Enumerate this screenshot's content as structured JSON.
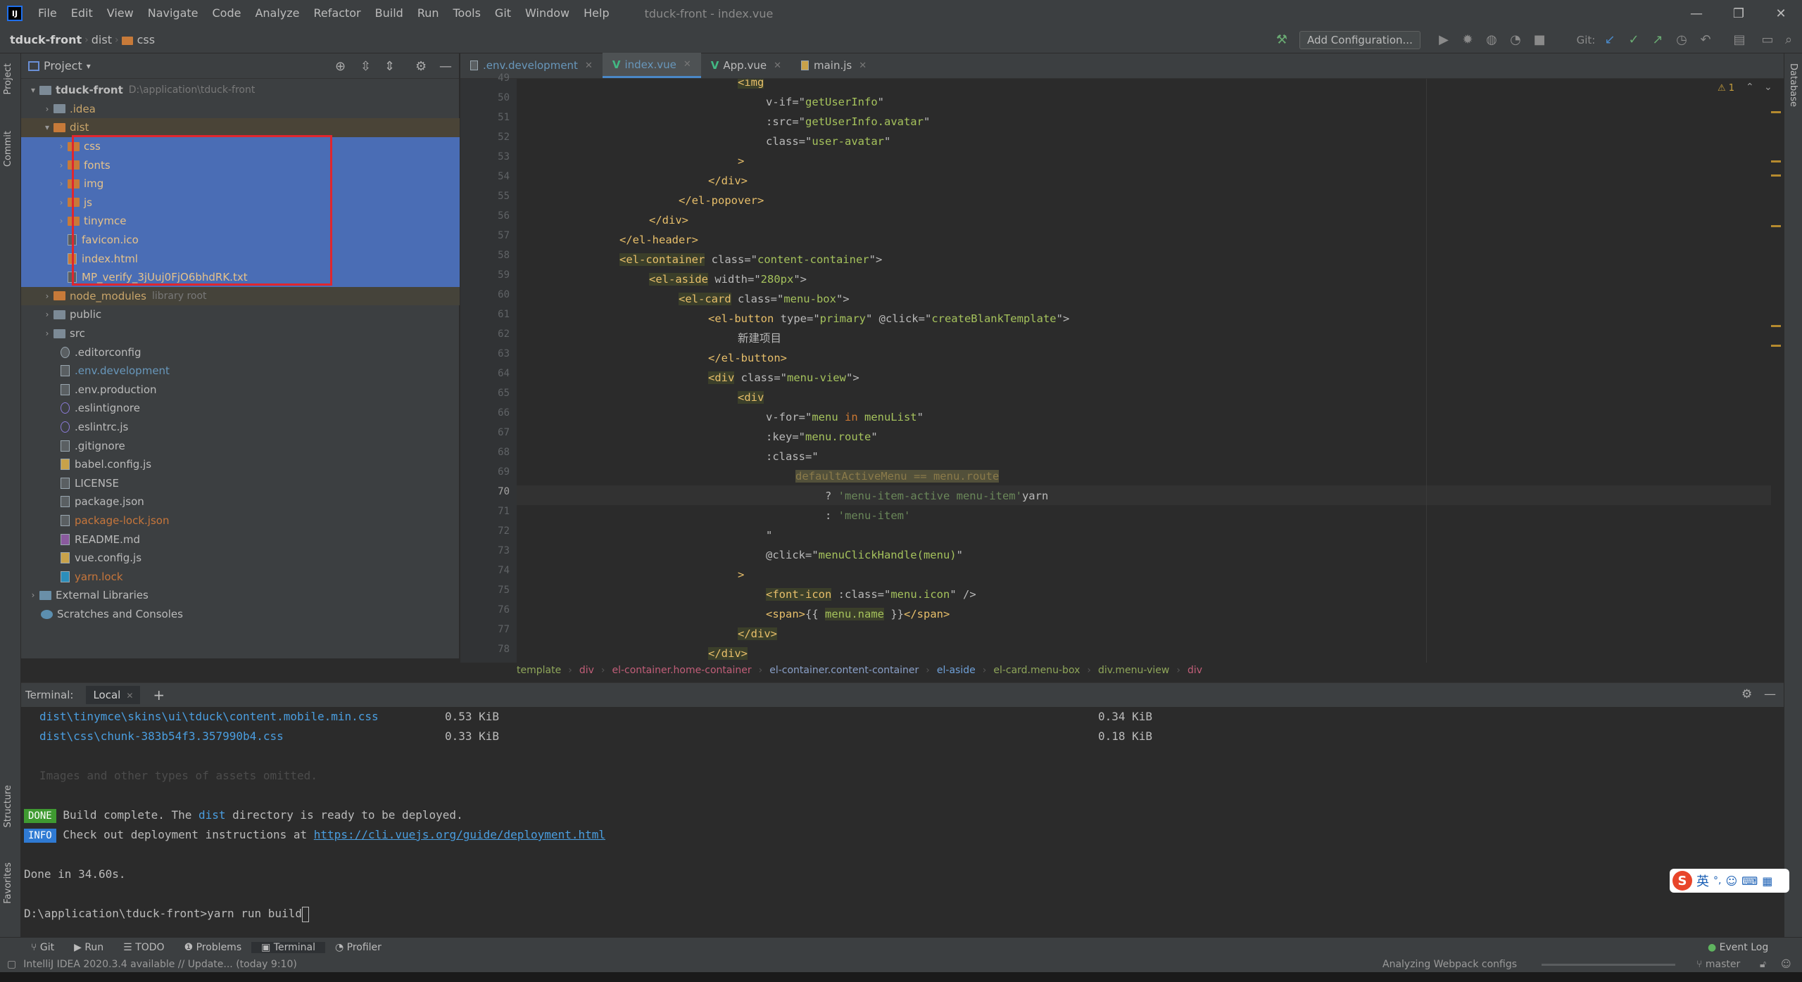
{
  "menu": {
    "items": [
      "File",
      "Edit",
      "View",
      "Navigate",
      "Code",
      "Analyze",
      "Refactor",
      "Build",
      "Run",
      "Tools",
      "Git",
      "Window",
      "Help"
    ],
    "window_title": "tduck-front - index.vue"
  },
  "navbar": {
    "crumbs": [
      "tduck-front",
      "dist",
      "css"
    ],
    "add_configuration": "Add Configuration...",
    "git_label": "Git:"
  },
  "left_strip": {
    "project": "Project",
    "commit": "Commit",
    "structure": "Structure",
    "favorites": "Favorites"
  },
  "right_strip": {
    "database": "Database"
  },
  "project_panel": {
    "title": "Project",
    "tree": [
      {
        "label": "tduck-front",
        "hint": "D:\\application\\tduck-front"
      },
      {
        "label": ".idea"
      },
      {
        "label": "dist"
      },
      {
        "label": "css"
      },
      {
        "label": "fonts"
      },
      {
        "label": "img"
      },
      {
        "label": "js"
      },
      {
        "label": "tinymce"
      },
      {
        "label": "favicon.ico"
      },
      {
        "label": "index.html"
      },
      {
        "label": "MP_verify_3jUuj0FjO6bhdRK.txt"
      },
      {
        "label": "node_modules",
        "hint": "library root"
      },
      {
        "label": "public"
      },
      {
        "label": "src"
      },
      {
        "label": ".editorconfig"
      },
      {
        "label": ".env.development"
      },
      {
        "label": ".env.production"
      },
      {
        "label": ".eslintignore"
      },
      {
        "label": ".eslintrc.js"
      },
      {
        "label": ".gitignore"
      },
      {
        "label": "babel.config.js"
      },
      {
        "label": "LICENSE"
      },
      {
        "label": "package.json"
      },
      {
        "label": "package-lock.json"
      },
      {
        "label": "README.md"
      },
      {
        "label": "vue.config.js"
      },
      {
        "label": "yarn.lock"
      },
      {
        "label": "External Libraries"
      },
      {
        "label": "Scratches and Consoles"
      }
    ]
  },
  "editor": {
    "tabs": [
      ".env.development",
      "index.vue",
      "App.vue",
      "main.js"
    ],
    "warnings": "1",
    "line_numbers": [
      "49",
      "50",
      "51",
      "52",
      "53",
      "54",
      "55",
      "56",
      "57",
      "58",
      "59",
      "60",
      "61",
      "62",
      "63",
      "64",
      "65",
      "66",
      "67",
      "68",
      "69",
      "70",
      "71",
      "72",
      "73",
      "74",
      "75",
      "76",
      "77",
      "78"
    ],
    "lines": {
      "l49": "<img",
      "l50a": "v-if=\"",
      "l50b": "getUserInfo",
      "l50c": "\"",
      "l51a": ":src=\"",
      "l51b": "getUserInfo.avatar",
      "l51c": "\"",
      "l52a": "class=\"",
      "l52b": "user-avatar",
      "l52c": "\"",
      "l53": ">",
      "l54": "</div>",
      "l55": "</el-popover>",
      "l56": "</div>",
      "l57": "</el-header>",
      "l58a": "<el-container",
      "l58b": " class=\"",
      "l58c": "content-container",
      "l58d": "\">",
      "l59a": "<el-aside",
      "l59b": " width=\"",
      "l59c": "280px",
      "l59d": "\">",
      "l60a": "<el-card",
      "l60b": " class=\"",
      "l60c": "menu-box",
      "l60d": "\">",
      "l61a": "<el-button",
      "l61b": " type=\"",
      "l61c": "primary",
      "l61d": "\" @click=\"",
      "l61e": "createBlankTemplate",
      "l61f": "\">",
      "l62": "新建项目",
      "l63": "</el-button>",
      "l64a": "<div",
      "l64b": " class=\"",
      "l64c": "menu-view",
      "l64d": "\">",
      "l65": "<div",
      "l66a": "v-for=\"",
      "l66b": "menu",
      "l66c": " in ",
      "l66d": "menuList",
      "l66e": "\"",
      "l67a": ":key=\"",
      "l67b": "menu.route",
      "l67c": "\"",
      "l68": ":class=\"",
      "l69a": "defaultActiveMenu",
      "l69b": " == ",
      "l69c": "menu.route",
      "l70a": "? ",
      "l70b": "'menu-item-active menu-item'",
      "l70c": "yarn",
      "l71a": ": ",
      "l71b": "'menu-item'",
      "l72": "\"",
      "l73a": "@click=\"",
      "l73b": "menuClickHandle(menu)",
      "l73c": "\"",
      "l74": ">",
      "l75a": "<font-icon",
      "l75b": " :class=\"",
      "l75c": "menu.icon",
      "l75d": "\" />",
      "l76a": "<span>",
      "l76b": "{{ ",
      "l76c": "menu.name",
      "l76d": " }}",
      "l76e": "</span>",
      "l77": "</div>",
      "l78": "</div>"
    },
    "breadcrumbs": [
      "template",
      "div",
      "el-container.home-container",
      "el-container.content-container",
      "el-aside",
      "el-card.menu-box",
      "div.menu-view",
      "div"
    ]
  },
  "terminal": {
    "label": "Terminal:",
    "tab": "Local",
    "rows": [
      {
        "file": "dist\\tinymce\\skins\\ui\\tduck\\content.mobile.min.css",
        "size": "0.53 KiB",
        "gzip": "0.34 KiB"
      },
      {
        "file": "dist\\css\\chunk-383b54f3.357990b4.css",
        "size": "0.33 KiB",
        "gzip": "0.18 KiB"
      }
    ],
    "omitted": "Images and other types of assets omitted.",
    "done_badge": "DONE",
    "done_text_a": "Build complete. The ",
    "done_text_dist": "dist",
    "done_text_b": " directory is ready to be deployed.",
    "info_badge": "INFO",
    "info_text": "Check out deployment instructions at ",
    "info_link": "https://cli.vuejs.org/guide/deployment.html",
    "done_time": "Done in 34.60s.",
    "prompt": "D:\\application\\tduck-front>yarn run build"
  },
  "ime": {
    "lang": "英"
  },
  "tool_tabs": [
    "Git",
    "Run",
    "TODO",
    "Problems",
    "Terminal",
    "Profiler"
  ],
  "event_log": "Event Log",
  "status": {
    "left": "IntelliJ IDEA 2020.3.4 available // Update... (today 9:10)",
    "progress": "Analyzing Webpack configs",
    "branch": "master"
  }
}
